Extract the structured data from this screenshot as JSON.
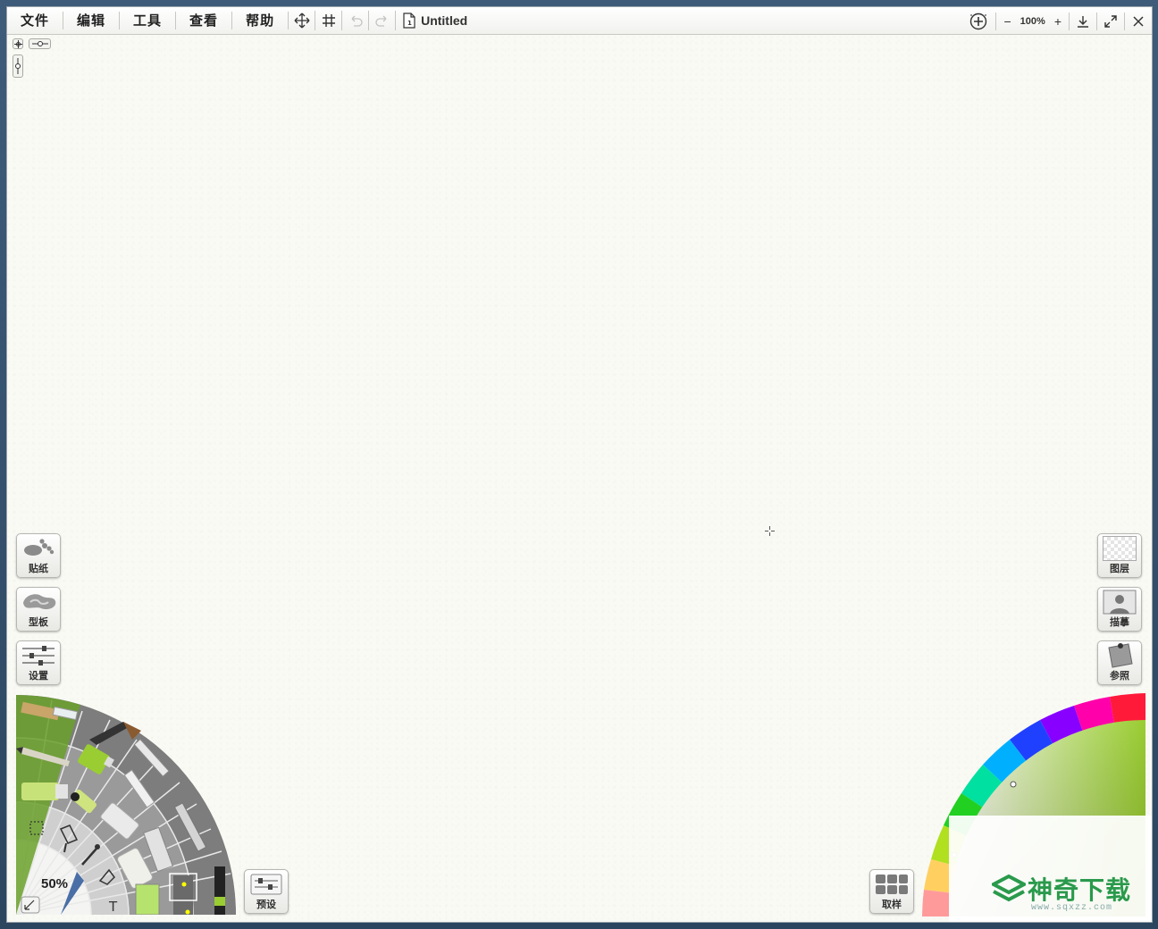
{
  "menubar": {
    "items": [
      "文件",
      "编辑",
      "工具",
      "查看",
      "帮助"
    ],
    "document_title": "Untitled",
    "zoom_level": "100%"
  },
  "left_panel": {
    "stickers_label": "贴纸",
    "stencils_label": "型板",
    "settings_label": "设置",
    "presets_label": "预设"
  },
  "right_panel": {
    "layers_label": "图层",
    "tracing_label": "描摹",
    "references_label": "参照",
    "sampler_label": "取样"
  },
  "tool_wheel": {
    "brush_size": "50%",
    "tools": [
      "brush",
      "palette-knife",
      "pencil",
      "paint-roller",
      "paint-tube",
      "ink-pen",
      "marker",
      "chalk",
      "crayon",
      "felt-pen",
      "airbrush",
      "glitter-tube",
      "eraser"
    ],
    "utility_tools": [
      "select",
      "fill",
      "eyedropper",
      "gloop",
      "text",
      "transform"
    ]
  },
  "color_picker": {
    "selected_color": "#9acd32",
    "accent": "#2a9a4c"
  },
  "watermark": {
    "text": "神奇下载",
    "url": "www.sqxzz.com"
  }
}
